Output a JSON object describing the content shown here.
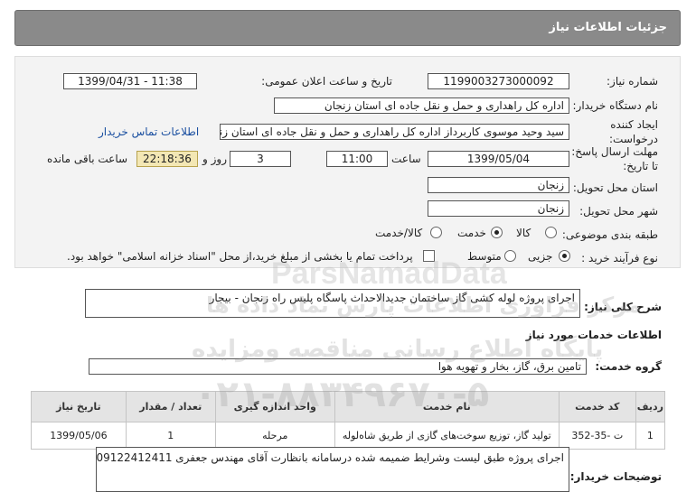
{
  "header": {
    "title": "جزئیات اطلاعات نیاز"
  },
  "fields": {
    "need_number_label": "شماره نیاز:",
    "need_number": "1199003273000092",
    "announce_label": "تاریخ و ساعت اعلان عمومی:",
    "announce_value": "1399/04/31 - 11:38",
    "buyer_org_label": "نام دستگاه خریدار:",
    "buyer_org": "اداره کل راهداری و حمل و نقل جاده ای استان زنجان",
    "creator_label_1": "ایجاد کننده",
    "creator_label_2": "درخواست:",
    "creator": "سید وحید موسوی کاربرداز اداره کل راهداری و حمل و نقل جاده ای استان زنجان",
    "contact_link": "اطلاعات تماس خریدار",
    "deadline_label_1": "مهلت ارسال پاسخ:",
    "deadline_label_2": "تا تاریخ:",
    "deadline_date": "1399/05/04",
    "time_label": "ساعت",
    "deadline_time": "11:00",
    "days_value": "3",
    "days_label": "روز و",
    "remaining_time": "22:18:36",
    "remaining_label": "ساعت باقی مانده",
    "province_label": "استان محل تحویل:",
    "province": "زنجان",
    "city_label": "شهر محل تحویل:",
    "city": "زنجان",
    "category_label": "طبقه بندی موضوعی:",
    "category_options": [
      "کالا",
      "خدمت",
      "کالا/خدمت"
    ],
    "process_label": "نوع فرآیند خرید :",
    "process_options": [
      "جزیی",
      "متوسط"
    ],
    "payment_note": "پرداخت تمام یا بخشی از مبلغ خرید،از محل \"اسناد خزانه اسلامی\" خواهد بود."
  },
  "summary": {
    "label": "شرح کلی نیاز:",
    "value": "اجرای پروژه لوله کشی گاز ساختمان جدیدالاحداث پاسگاه پلیس راه زنجان - بیجار"
  },
  "services": {
    "section_title": "اطلاعات خدمات مورد نیاز",
    "group_label": "گروه خدمت:",
    "group_value": "تامین برق، گاز، بخار و تهویه هوا"
  },
  "table": {
    "headers": [
      "ردیف",
      "کد خدمت",
      "نام خدمت",
      "واحد اندازه گیری",
      "تعداد / مقدار",
      "تاریخ نیاز"
    ],
    "rows": [
      [
        "1",
        "ت -35-352",
        "تولید گاز، توزیع سوخت‌های گازی از طریق شاه‌لوله",
        "مرحله",
        "1",
        "1399/05/06"
      ]
    ]
  },
  "buyer_notes": {
    "label": "توضیحات خریدار:",
    "value": "اجرای پروژه طبق لیست وشرایط ضمیمه شده درسامانه بانظارت آقای مهندس جعفری 09122412411"
  },
  "watermark": {
    "line1": "ParsNamadData",
    "line2": "مرکز فراوری اطلاعات پارس نماد داده ها",
    "line3": "پایگاه اطلاع رسانی مناقصه ومزایده",
    "line4": "۰۲۱-۸۸۳۴۹۶۷۰-۵"
  }
}
